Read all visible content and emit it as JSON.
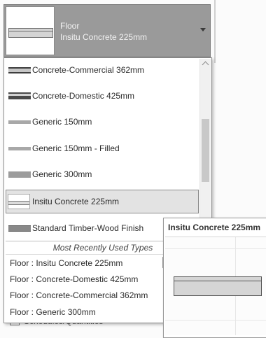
{
  "type_selector": {
    "category": "Floor",
    "type_name": "Insitu Concrete 225mm"
  },
  "type_list": [
    {
      "label": "Concrete-Commercial 362mm",
      "swatch": "heavy"
    },
    {
      "label": "Concrete-Domestic 425mm",
      "swatch": "heavy2"
    },
    {
      "label": "Generic 150mm",
      "swatch": "thin"
    },
    {
      "label": "Generic 150mm - Filled",
      "swatch": "thin"
    },
    {
      "label": "Generic 300mm",
      "swatch": "medium"
    },
    {
      "label": "Insitu Concrete 225mm",
      "swatch": "insitu",
      "selected": true
    },
    {
      "label": "Standard Timber-Wood Finish",
      "swatch": "timber"
    }
  ],
  "mru": {
    "header": "Most Recently Used Types",
    "items": [
      "Floor : Insitu Concrete 225mm",
      "Floor : Concrete-Domestic 425mm",
      "Floor : Concrete-Commercial 362mm",
      "Floor : Generic 300mm"
    ]
  },
  "tooltip": {
    "title": "Insitu Concrete 225mm"
  },
  "background": {
    "tree_item": "Schedules/Quantities"
  },
  "colors": {
    "selector_bg": "#9a9a9a",
    "selected_row_bg": "#e3e3e3"
  }
}
